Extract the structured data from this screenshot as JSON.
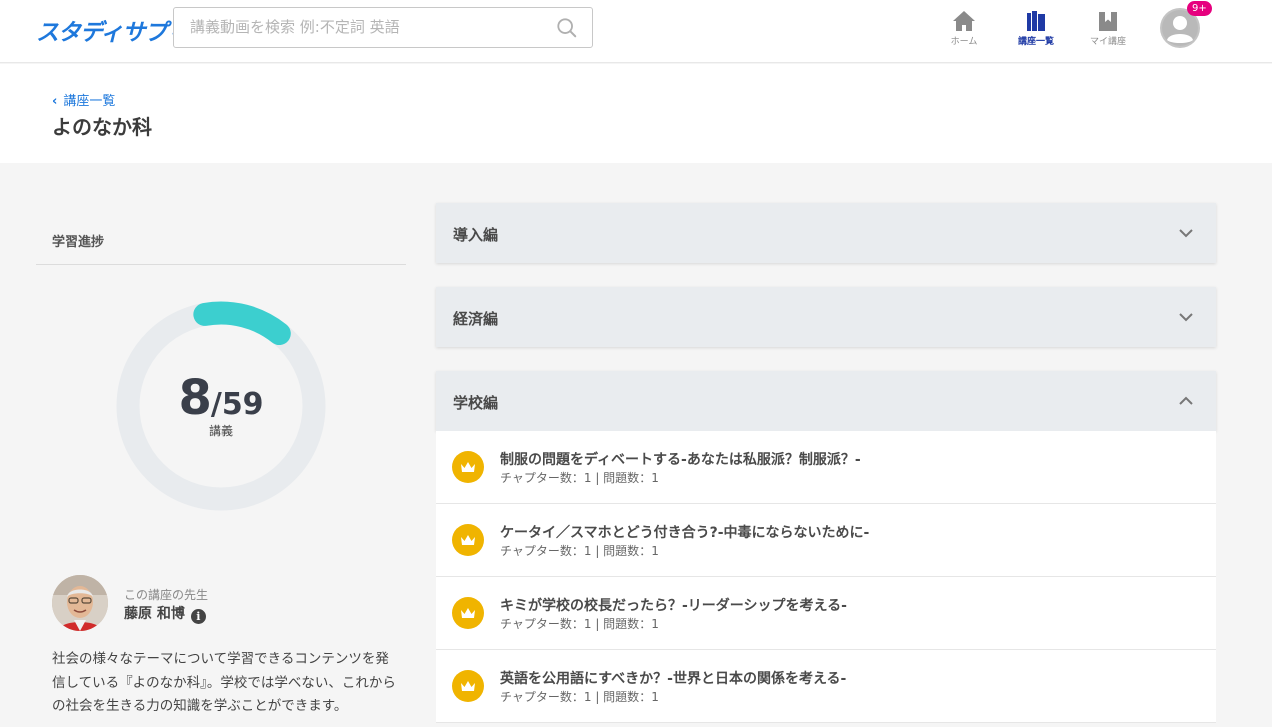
{
  "header": {
    "logo": "スタディサプリ",
    "search_placeholder": "講義動画を検索 例:不定詞 英語",
    "nav": [
      {
        "label": "ホーム",
        "icon": "home-icon"
      },
      {
        "label": "講座一覧",
        "icon": "course-list-icon"
      },
      {
        "label": "マイ講座",
        "icon": "my-course-icon"
      }
    ],
    "notification_badge": "9+"
  },
  "title_band": {
    "back_label": "講座一覧",
    "page_title": "よのなか科"
  },
  "progress": {
    "label": "学習進捗",
    "completed": "8",
    "slash": "/",
    "total": "59",
    "unit": "講義",
    "fraction": 0.1356,
    "track_color": "#e8ebee",
    "fill_color": "#3ccfcf"
  },
  "teacher": {
    "role": "この講座の先生",
    "name": "藤原 和博",
    "description": "社会の様々なテーマについて学習できるコンテンツを発信している『よのなか科』。学校では学べない、これからの社会を生きる力の知識を学ぶことができます。"
  },
  "sections": [
    {
      "title": "導入編",
      "expanded": false
    },
    {
      "title": "経済編",
      "expanded": false
    },
    {
      "title": "学校編",
      "expanded": true
    }
  ],
  "lectures": [
    {
      "title": "制服の問題をディベートする-あなたは私服派？制服派？-",
      "meta": "チャプター数：1 | 問題数：1"
    },
    {
      "title": "ケータイ／スマホとどう付き合う?-中毒にならないために-",
      "meta": "チャプター数：1 | 問題数：1"
    },
    {
      "title": "キミが学校の校長だったら？-リーダーシップを考える-",
      "meta": "チャプター数：1 | 問題数：1"
    },
    {
      "title": "英語を公用語にすべきか？-世界と日本の関係を考える-",
      "meta": "チャプター数：1 | 問題数：1"
    }
  ],
  "colors": {
    "accent": "#1e78dc",
    "crown": "#f0b400",
    "badge": "#e6007e"
  }
}
